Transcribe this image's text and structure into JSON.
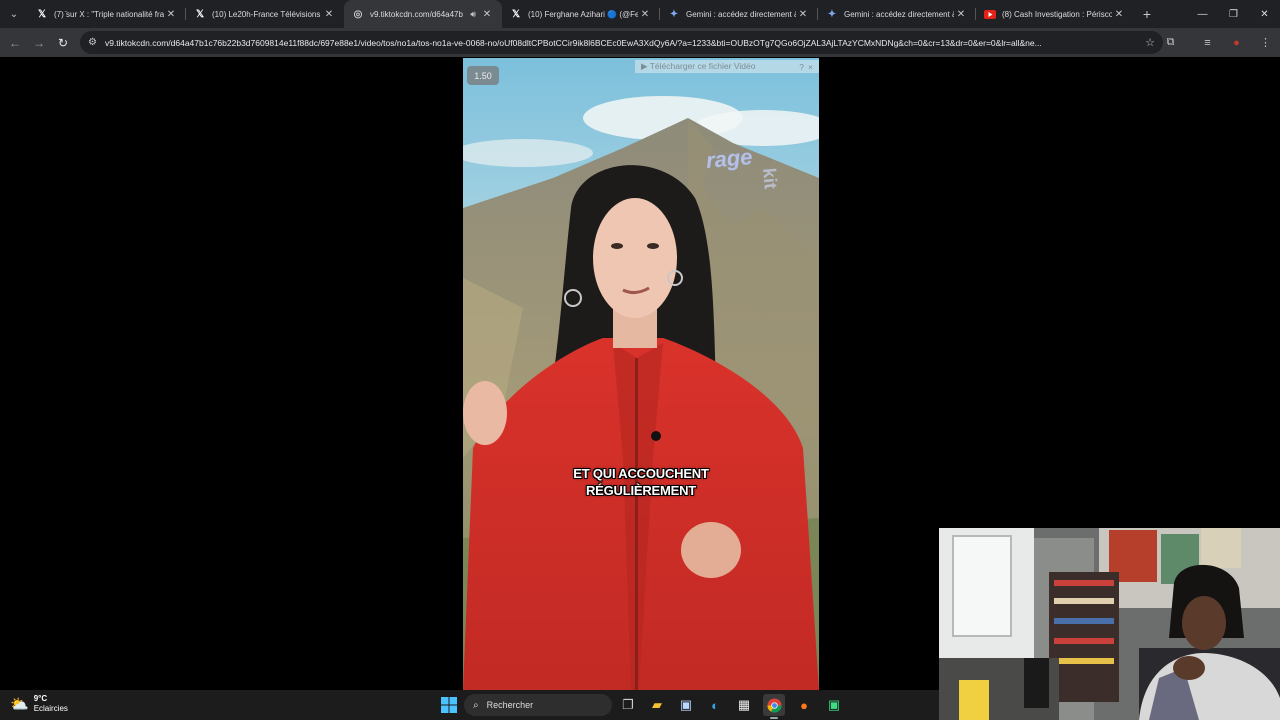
{
  "browser": {
    "tabs": [
      {
        "title": "(7) ̈sur X : \"Triple nationalité fra",
        "favicon": "x-icon",
        "active": false
      },
      {
        "title": "(10) Le20h-France Télévisions s",
        "favicon": "x-icon",
        "active": false
      },
      {
        "title": "v9.tiktokcdn.com/d64a47b",
        "favicon": "globe-icon",
        "active": true,
        "audio": true
      },
      {
        "title": "(10) Ferghane Azihari 🔵 (@Fe",
        "favicon": "x-icon",
        "active": false
      },
      {
        "title": "Gemini : accédez directement à",
        "favicon": "gemini-icon",
        "active": false
      },
      {
        "title": "Gemini : accédez directement à",
        "favicon": "gemini-icon",
        "active": false
      },
      {
        "title": "(8) Cash Investigation : Périscol",
        "favicon": "youtube-icon",
        "active": false
      }
    ],
    "url": "v9.tiktokcdn.com/d64a47b1c76b22b3d7609814e11f88dc/697e88e1/video/tos/no1a/tos-no1a-ve-0068-no/oUf08dltCPBotCCir9ik8l6BCEc0EwA3XdQy6A/?a=1233&bti=OUBzOTg7QGo6OjZAL3AjLTAzYCMxNDNg&ch=0&cr=13&dr=0&er=0&lr=all&ne..."
  },
  "video": {
    "speed_label": "1.50",
    "download_label": "▶ Télécharger ce fichier Vidéo",
    "download_help": "?",
    "download_close": "×",
    "caption_line1": "ET QUI ACCOUCHENT",
    "caption_line2": "RÉGULIÈREMENT",
    "watermark": "rage",
    "watermark2": "kit"
  },
  "taskbar": {
    "temperature": "9°C",
    "condition": "Eclaircies",
    "search_label": "Rechercher"
  },
  "colors": {
    "jacket": "#d9322b",
    "sky": "#8fc4d8",
    "taskbar": "#1c1c1c"
  }
}
